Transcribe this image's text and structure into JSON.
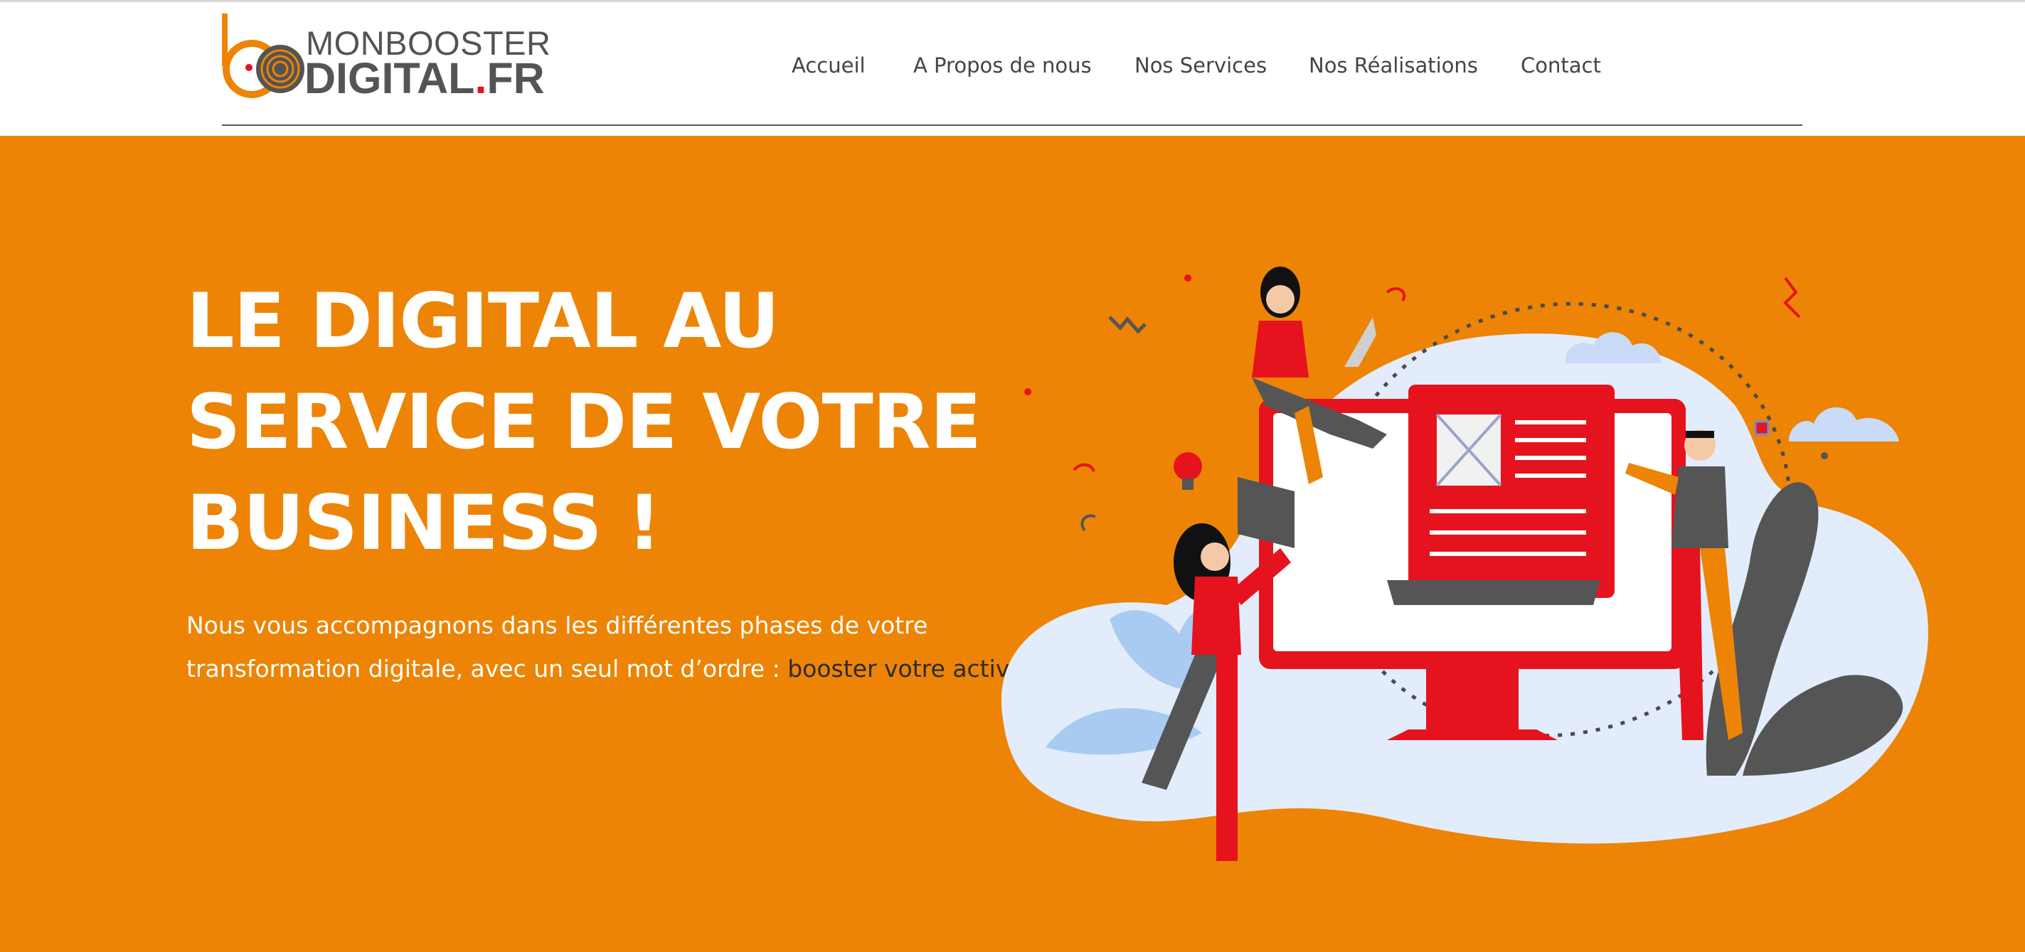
{
  "brand": {
    "line1": "MONBOOSTER",
    "line2_main": "DIGITAL",
    "line2_dot": ".",
    "line2_tld": "FR",
    "colors": {
      "orange": "#ed8405",
      "red": "#e5131d",
      "grey": "#545454"
    }
  },
  "nav": {
    "items": [
      {
        "label": "Accueil"
      },
      {
        "label": "A Propos de nous"
      },
      {
        "label": "Nos Services"
      },
      {
        "label": "Nos Réalisations"
      },
      {
        "label": "Contact"
      }
    ]
  },
  "hero": {
    "title_lines": [
      "LE DIGITAL AU",
      "SERVICE DE VOTRE",
      "BUSINESS !"
    ],
    "desc_line1": "Nous vous accompagnons dans les différentes phases de votre",
    "desc_line2_start": "transformation digitale, avec un seul mot d’ordre : ",
    "desc_line2_highlight": "booster votre activité!",
    "illustration": "digital-team-working-on-website-illustration"
  }
}
